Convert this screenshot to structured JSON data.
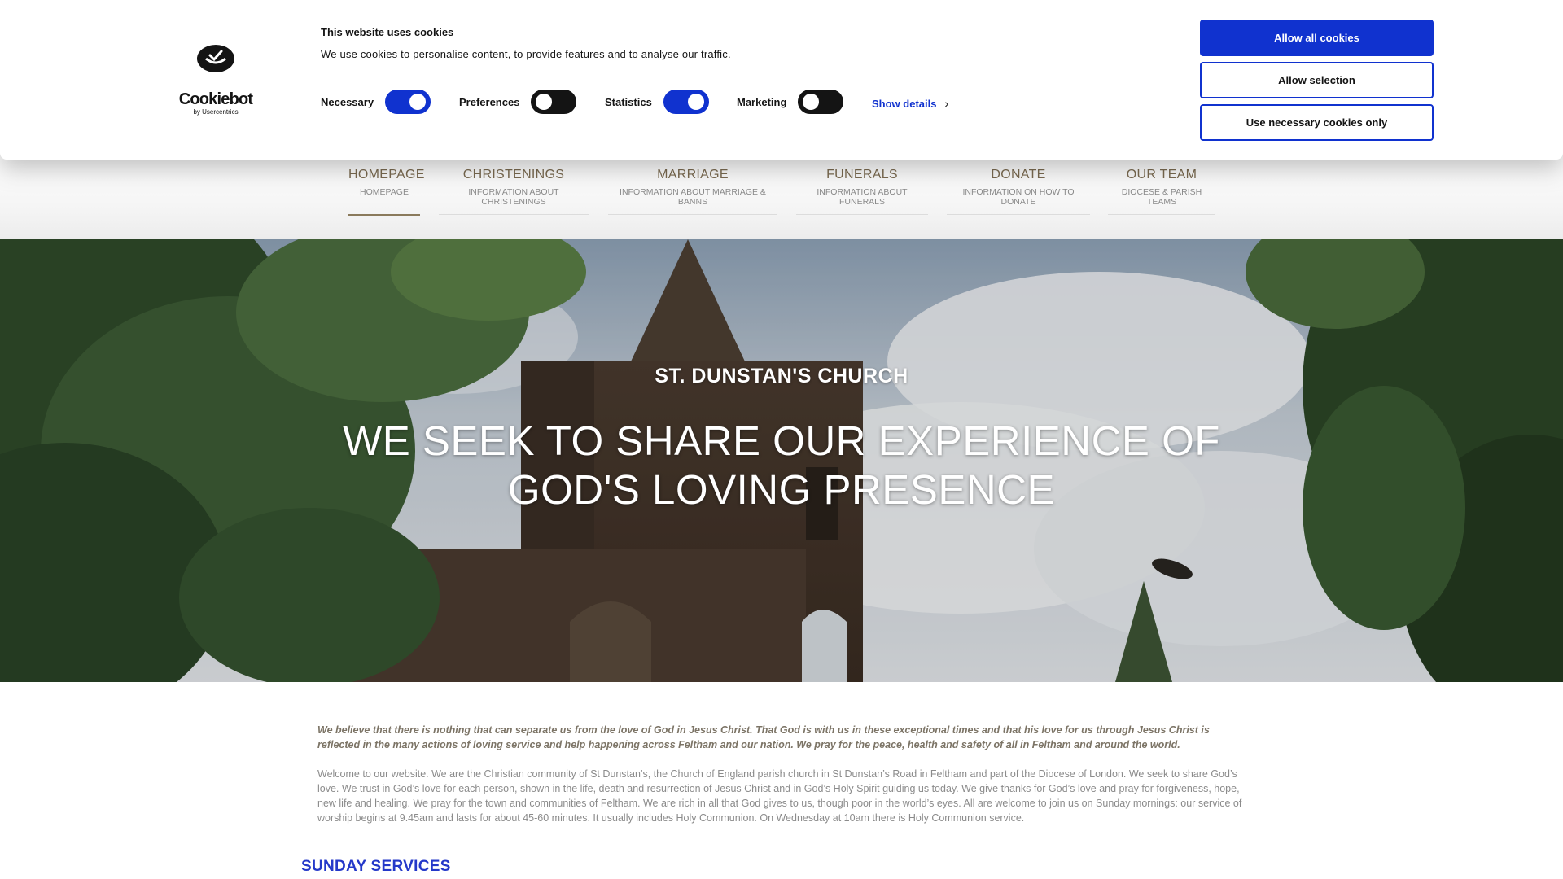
{
  "cookie_banner": {
    "logo_word": "Cookiebot",
    "logo_sub": "by Usercentrics",
    "title": "This website uses cookies",
    "description": "We use cookies to personalise content, to provide features and to analyse our traffic.",
    "toggles": [
      {
        "label": "Necessary",
        "state": "on"
      },
      {
        "label": "Preferences",
        "state": "off"
      },
      {
        "label": "Statistics",
        "state": "on"
      },
      {
        "label": "Marketing",
        "state": "off"
      }
    ],
    "show_details": "Show details",
    "buttons": {
      "allow_all": "Allow all cookies",
      "allow_selection": "Allow selection",
      "necessary_only": "Use necessary cookies only"
    },
    "accent_color": "#1032cf"
  },
  "nav": {
    "items": [
      {
        "title": "HOMEPAGE",
        "sub": "HOMEPAGE",
        "active": true
      },
      {
        "title": "CHRISTENINGS",
        "sub": "INFORMATION ABOUT CHRISTENINGS"
      },
      {
        "title": "MARRIAGE",
        "sub": "INFORMATION ABOUT MARRIAGE & BANNS"
      },
      {
        "title": "FUNERALS",
        "sub": "INFORMATION ABOUT FUNERALS"
      },
      {
        "title": "DONATE",
        "sub": "INFORMATION ON HOW TO DONATE"
      },
      {
        "title": "OUR TEAM",
        "sub": "DIOCESE & PARISH TEAMS"
      }
    ]
  },
  "hero": {
    "subtitle": "ST. DUNSTAN'S CHURCH",
    "title": "WE SEEK TO SHARE OUR EXPERIENCE OF GOD'S LOVING PRESENCE"
  },
  "content": {
    "intro_bold": "We believe that there is nothing that can separate us from the love of God in Jesus Christ. That God is with us in these exceptional times and that his love for us through Jesus Christ is reflected in the many actions of loving service and help happening across Feltham and our nation. We pray for the peace, health and safety of all in Feltham and around the world.",
    "intro_text": "Welcome to our website. We are the Christian community of St Dunstan’s, the Church of England parish church in St Dunstan’s Road in Feltham and part of the Diocese of London. We seek to share God’s love. We trust in God’s love for each person, shown in the life, death and resurrection of Jesus Christ and in God’s Holy Spirit guiding us today. We give thanks for God’s love and pray for forgiveness, hope, new life and healing. We pray for the town and communities of Feltham. We are rich in all that God gives to us, though poor in the world’s eyes. All are welcome to join us on Sunday mornings: our service of worship begins at 9.45am and lasts for about 45-60 minutes. It usually includes Holy Communion. On Wednesday at 10am there is Holy Communion service.",
    "section_heading": "SUNDAY SERVICES"
  }
}
